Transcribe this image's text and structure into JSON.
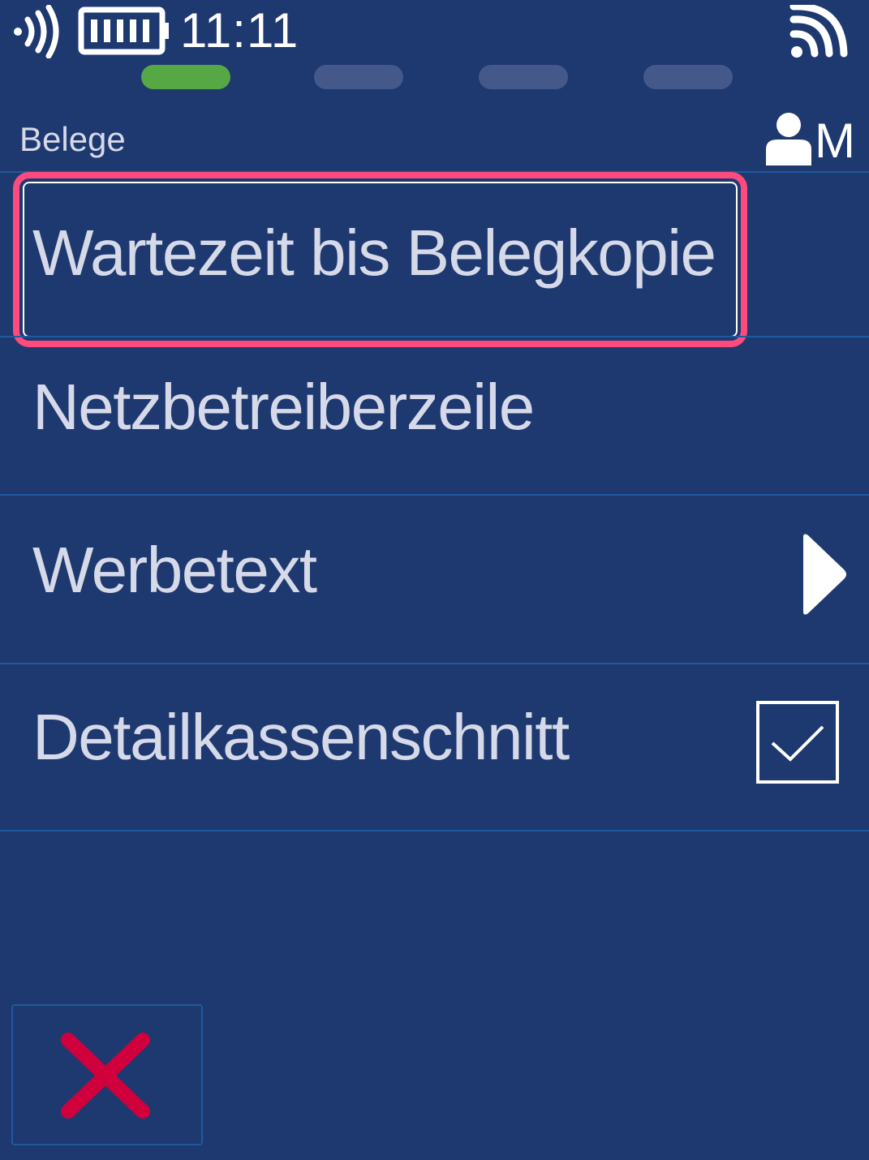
{
  "status_bar": {
    "time": "11:11",
    "icons": [
      "nfc-icon",
      "battery-icon",
      "wifi-icon"
    ]
  },
  "steps": {
    "total": 4,
    "active_index": 0,
    "colors": {
      "active": "#55a844",
      "inactive": "#44598a"
    }
  },
  "header": {
    "title": "Belege",
    "user_letter": "M",
    "icon": "user-icon"
  },
  "menu": {
    "items": [
      {
        "label": "Wartezeit bis Belegkopie",
        "focused": true
      },
      {
        "label": "Netzbetreiberzeile"
      },
      {
        "label": "Werbetext",
        "indicator": "chevron-right-icon"
      },
      {
        "label": "Detailkassenschnitt",
        "indicator": "checkbox",
        "checked": true
      }
    ]
  },
  "footer": {
    "cancel_icon": "close-icon"
  },
  "colors": {
    "background": "#1e3870",
    "text": "#d6d9e8",
    "focus": "#ff4a7d",
    "cancel": "#d0003c",
    "divider": "#1f5aa0"
  }
}
